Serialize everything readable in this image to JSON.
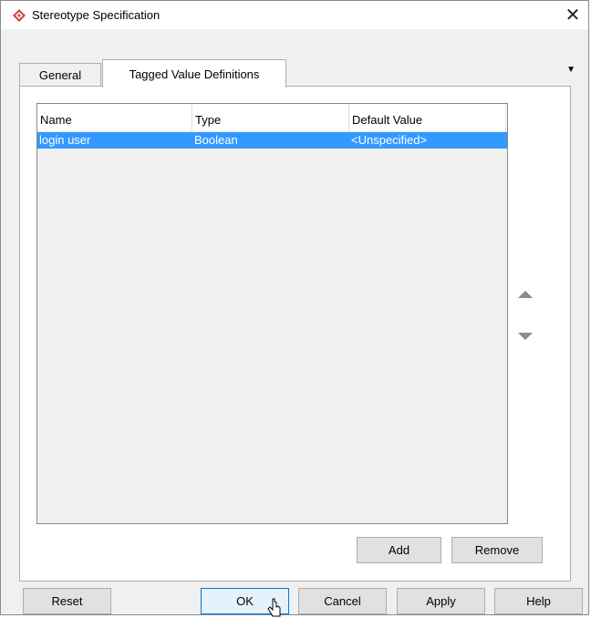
{
  "window": {
    "title": "Stereotype Specification",
    "close_glyph": "✕",
    "icon": "diamond-logo-icon",
    "accent": "#d64541"
  },
  "tabs": [
    {
      "label": "General",
      "active": false
    },
    {
      "label": "Tagged Value Definitions",
      "active": true
    }
  ],
  "tab_menu_glyph": "▼",
  "table": {
    "columns": [
      "Name",
      "Type",
      "Default Value"
    ],
    "rows": [
      {
        "name": "login user",
        "type": "Boolean",
        "default": "<Unspecified>",
        "selected": true
      }
    ],
    "selection_color": "#3399ff"
  },
  "side_buttons": {
    "up": "move-up-icon",
    "down": "move-down-icon"
  },
  "panel_buttons": {
    "add": "Add",
    "remove": "Remove"
  },
  "footer_buttons": {
    "reset": "Reset",
    "ok": "OK",
    "cancel": "Cancel",
    "apply": "Apply",
    "help": "Help"
  }
}
